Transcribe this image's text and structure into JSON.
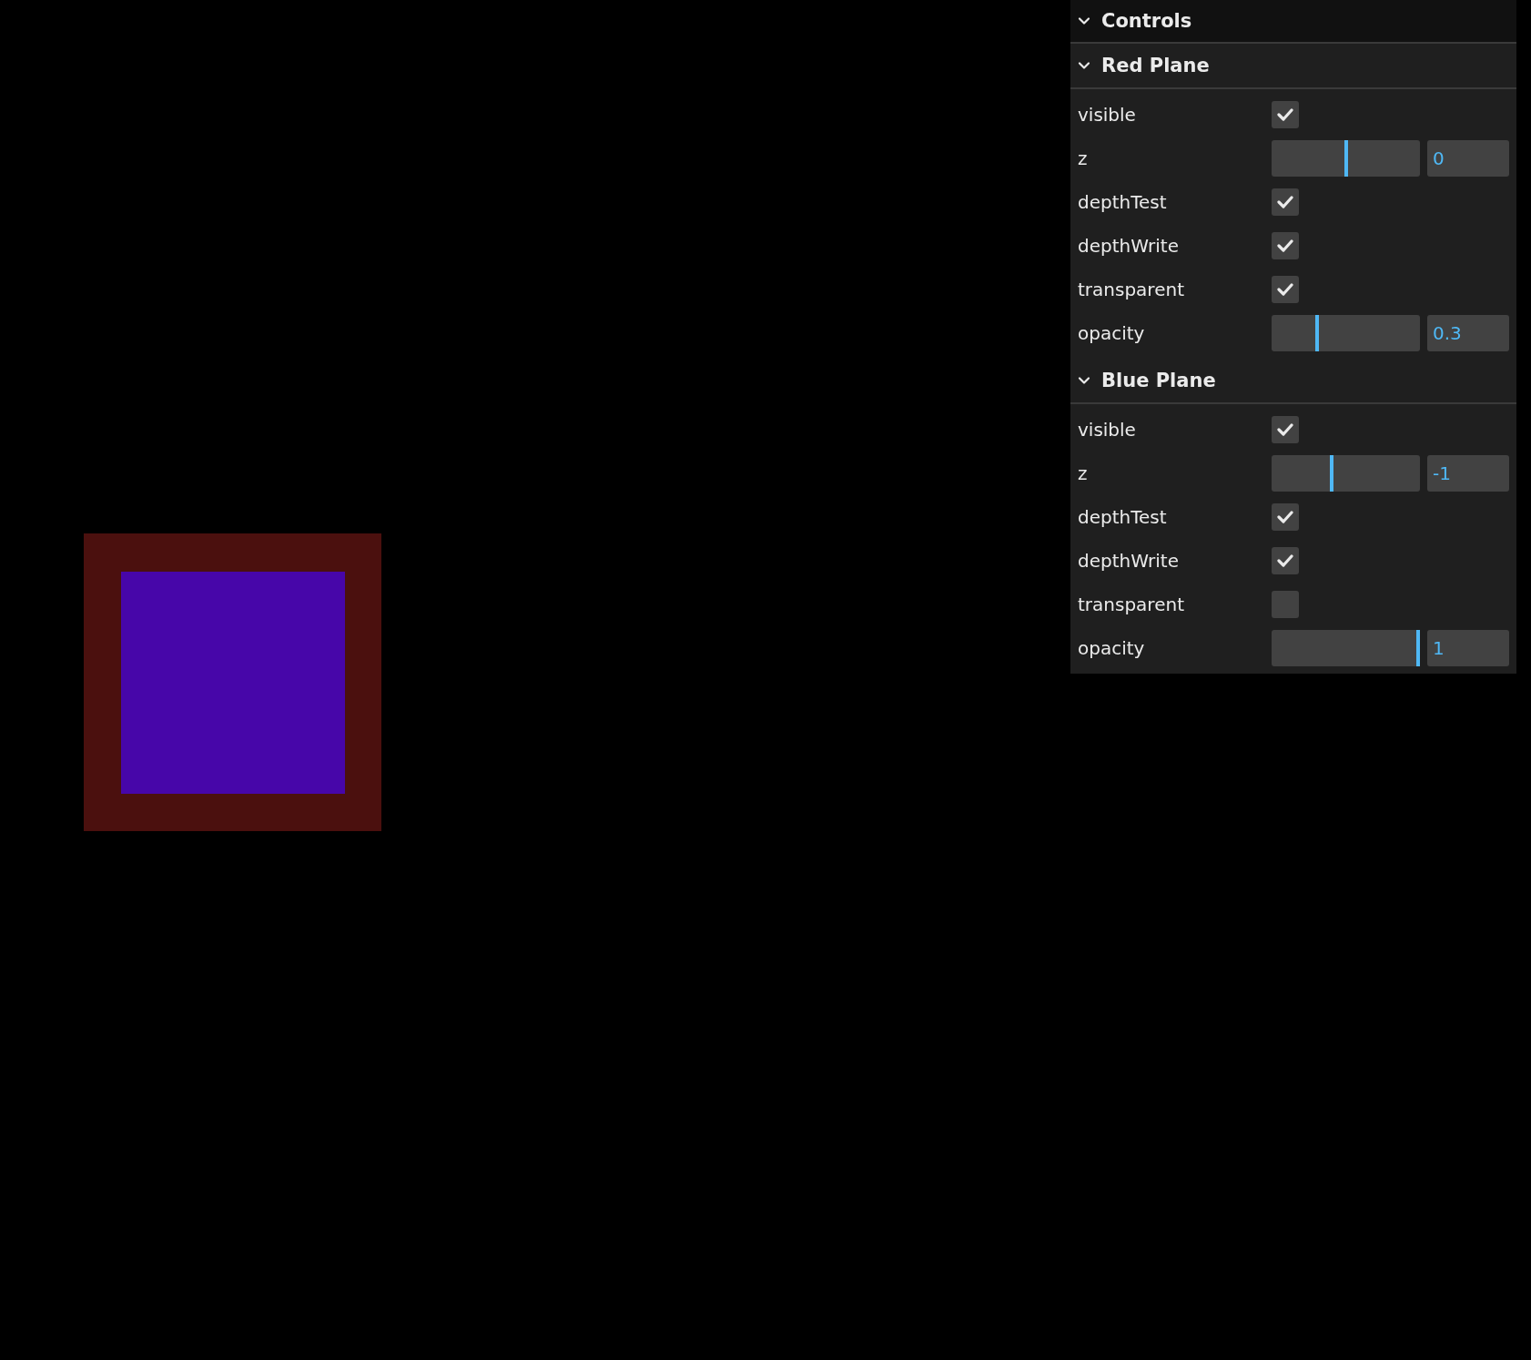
{
  "panel": {
    "title": "Controls",
    "expanded": true,
    "folders": [
      {
        "title": "Red Plane",
        "expanded": true,
        "controls": [
          {
            "kind": "checkbox",
            "label": "visible",
            "checked": true
          },
          {
            "kind": "slider",
            "label": "z",
            "level": 0.5,
            "value": "0"
          },
          {
            "kind": "checkbox",
            "label": "depthTest",
            "checked": true
          },
          {
            "kind": "checkbox",
            "label": "depthWrite",
            "checked": true
          },
          {
            "kind": "checkbox",
            "label": "transparent",
            "checked": true
          },
          {
            "kind": "slider",
            "label": "opacity",
            "level": 0.3,
            "value": "0.3"
          }
        ]
      },
      {
        "title": "Blue Plane",
        "expanded": true,
        "controls": [
          {
            "kind": "checkbox",
            "label": "visible",
            "checked": true
          },
          {
            "kind": "slider",
            "label": "z",
            "level": 0.4,
            "value": "-1"
          },
          {
            "kind": "checkbox",
            "label": "depthTest",
            "checked": true
          },
          {
            "kind": "checkbox",
            "label": "depthWrite",
            "checked": true
          },
          {
            "kind": "checkbox",
            "label": "transparent",
            "checked": false
          },
          {
            "kind": "slider",
            "label": "opacity",
            "level": 1,
            "value": "1"
          }
        ]
      }
    ]
  }
}
